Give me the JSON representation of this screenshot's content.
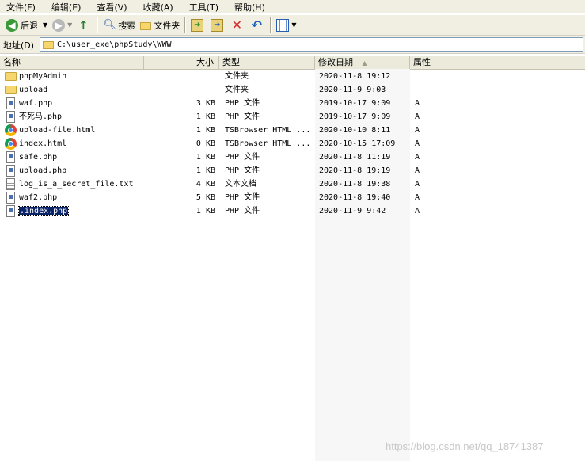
{
  "menu": [
    "文件(F)",
    "编辑(E)",
    "查看(V)",
    "收藏(A)",
    "工具(T)",
    "帮助(H)"
  ],
  "toolbar": {
    "back_label": "后退",
    "search_label": "搜索",
    "folders_label": "文件夹"
  },
  "address": {
    "label": "地址(D)",
    "path": "C:\\user_exe\\phpStudy\\WWW"
  },
  "columns": {
    "name": "名称",
    "size": "大小",
    "type": "类型",
    "modified": "修改日期",
    "attributes": "属性"
  },
  "files": [
    {
      "name": "phpMyAdmin",
      "size": "",
      "type": "文件夹",
      "modified": "2020-11-8 19:12",
      "attr": "",
      "icon": "folder-icon"
    },
    {
      "name": "upload",
      "size": "",
      "type": "文件夹",
      "modified": "2020-11-9 9:03",
      "attr": "",
      "icon": "folder-icon"
    },
    {
      "name": "waf.php",
      "size": "3 KB",
      "type": "PHP 文件",
      "modified": "2019-10-17 9:09",
      "attr": "A",
      "icon": "php-file-icon"
    },
    {
      "name": "不死马.php",
      "size": "1 KB",
      "type": "PHP 文件",
      "modified": "2019-10-17 9:09",
      "attr": "A",
      "icon": "php-file-icon"
    },
    {
      "name": "upload-file.html",
      "size": "1 KB",
      "type": "TSBrowser HTML ...",
      "modified": "2020-10-10 8:11",
      "attr": "A",
      "icon": "browser-html-icon"
    },
    {
      "name": "index.html",
      "size": "0 KB",
      "type": "TSBrowser HTML ...",
      "modified": "2020-10-15 17:09",
      "attr": "A",
      "icon": "browser-html-icon"
    },
    {
      "name": "safe.php",
      "size": "1 KB",
      "type": "PHP 文件",
      "modified": "2020-11-8 11:19",
      "attr": "A",
      "icon": "php-file-icon"
    },
    {
      "name": "upload.php",
      "size": "1 KB",
      "type": "PHP 文件",
      "modified": "2020-11-8 19:19",
      "attr": "A",
      "icon": "php-file-icon"
    },
    {
      "name": "log_is_a_secret_file.txt",
      "size": "4 KB",
      "type": "文本文档",
      "modified": "2020-11-8 19:38",
      "attr": "A",
      "icon": "text-file-icon"
    },
    {
      "name": "waf2.php",
      "size": "5 KB",
      "type": "PHP 文件",
      "modified": "2020-11-8 19:40",
      "attr": "A",
      "icon": "php-file-icon"
    },
    {
      "name": ".index.php",
      "size": "1 KB",
      "type": "PHP 文件",
      "modified": "2020-11-9 9:42",
      "attr": "A",
      "icon": "php-file-icon",
      "selected": true
    }
  ],
  "watermark": "https://blog.csdn.net/qq_18741387",
  "colors": {
    "selection": "#0a246a",
    "toolbar_bg": "#f1efe2",
    "header_bg": "#ebeadb",
    "folder": "#f5d76e"
  }
}
